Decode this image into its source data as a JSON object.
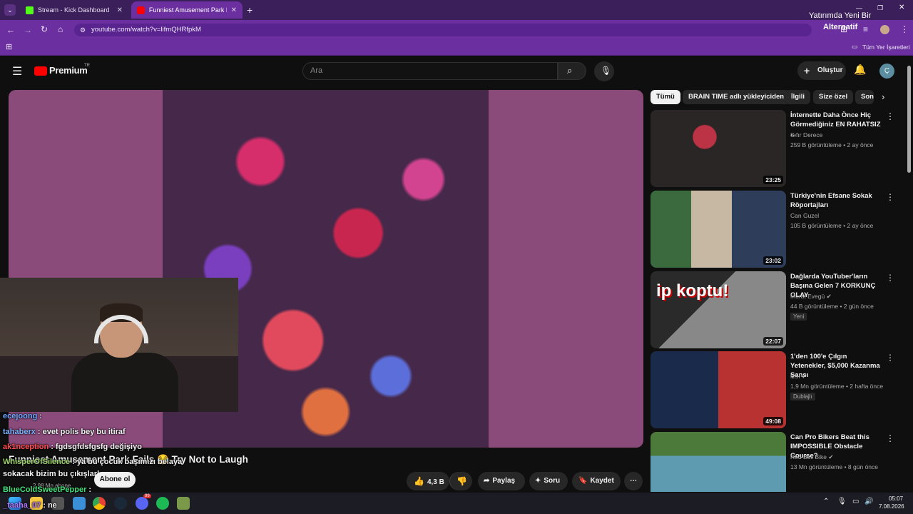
{
  "browser": {
    "tabs": [
      {
        "title": "Stream - Kick Dashboard",
        "active": false
      },
      {
        "title": "Funniest Amusement Park Fails",
        "active": true
      }
    ],
    "url": "youtube.com/watch?v=lifmQHRfpkM",
    "bookmarks_label": "Tüm Yer İşaretleri",
    "overlay_text_1": "Yatırımda Yeni Bir",
    "overlay_text_2": "Alternatif"
  },
  "youtube": {
    "logo": "Premium",
    "logo_badge": "TR",
    "search_placeholder": "Ara",
    "create_label": "Oluştur",
    "avatar_letter": "Ç"
  },
  "video": {
    "title": "Funniest Amusement Park Fails 😂 Try Not to Laugh",
    "subscriber_count": "2,98 Mn abone",
    "subscribe_label": "Abone ol",
    "likes": "4,3 B",
    "share_label": "Paylaş",
    "ask_label": "Soru",
    "save_label": "Kaydet"
  },
  "chat": [
    {
      "user": "ecejoong",
      "text": ":",
      "color": "#6fa8ff"
    },
    {
      "user": "tahaberx",
      "text": ": evet polis bey bu itiraf",
      "color": "#7fb6ff"
    },
    {
      "user": "ak1nception",
      "text": ": fgdsgfdsfgsfg değişiyo",
      "color": "#ff4d4d"
    },
    {
      "user": "WhisperOfSilence",
      "text": ": ya bu çocuk başımızı belaya",
      "color": "#9ad06a"
    },
    {
      "user": "",
      "text": "sokacak bizim bu çıkışlarla",
      "color": "#ffffff"
    },
    {
      "user": "BlueColdSweetPepper",
      "text": ":",
      "color": "#44e07a"
    },
    {
      "user": "_taaha_07",
      "text": ": ne",
      "color": "#b37aff"
    }
  ],
  "filters": [
    "Tümü",
    "BRAIN TIME adlı yükleyiciden",
    "İlgili",
    "Size özel",
    "Son"
  ],
  "recommendations": [
    {
      "title": "İnternette Daha Önce Hiç Görmediğiniz EN RAHATSIZ ...",
      "channel": "Sıfır Derece",
      "meta": "259 B görüntüleme • 2 ay önce",
      "duration": "23:25",
      "badge": "",
      "verified": false
    },
    {
      "title": "Türkiye'nin Efsane Sokak Röportajları",
      "channel": "Can Guzel",
      "meta": "105 B görüntüleme • 2 ay önce",
      "duration": "23:02",
      "badge": "",
      "verified": false
    },
    {
      "title": "Dağlarda YouTuber'ların Başına Gelen 7 KORKUNÇ OLAY",
      "channel": "Murat Evegü",
      "meta": "44 B görüntüleme • 2 gün önce",
      "duration": "22:07",
      "badge": "Yeni",
      "verified": true
    },
    {
      "title": "1'den 100'e Çılgın Yetenekler, $5,000 Kazanma Şansı",
      "channel": "KSI",
      "meta": "1,9 Mn görüntüleme • 2 hafta önce",
      "duration": "49:08",
      "badge": "Dublajlı",
      "verified": true
    },
    {
      "title": "Can Pro Bikers Beat this IMPOSSIBLE Obstacle Course?",
      "channel": "Red Bull Bike",
      "meta": "13 Mn görüntüleme • 8 gün önce",
      "duration": "",
      "badge": "",
      "verified": true
    }
  ],
  "thumb_text": "ip koptu!",
  "taskbar": {
    "time": "05:07",
    "date": "7.08.2026",
    "discord_badge": "99"
  }
}
